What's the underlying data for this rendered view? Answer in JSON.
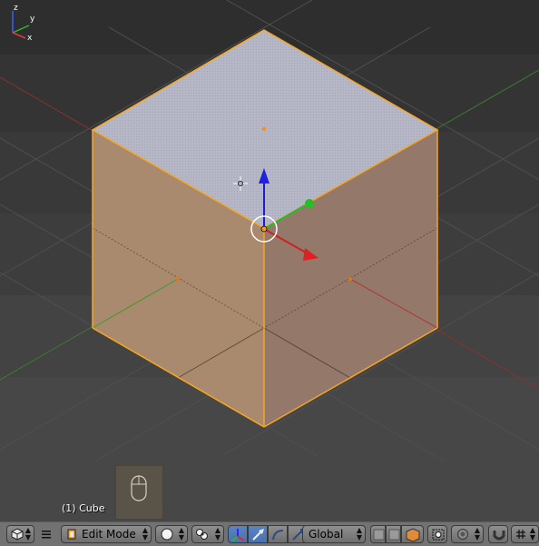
{
  "viewport": {
    "object_label": "(1) Cube",
    "axis_labels": {
      "x": "x",
      "y": "y",
      "z": "z"
    }
  },
  "header": {
    "editor_type_icon": "viewport-cube-icon",
    "menu_icon": "hamburger-menu-icon",
    "mode_label": "Edit Mode",
    "shading_icon": "solid-sphere-icon",
    "pivot_icon": "pivot-point-icon",
    "orientation_label": "Global",
    "colors": {
      "header_bg": "#727272",
      "active_blue": "#4a72ad",
      "selection_orange": "#f5a623"
    }
  }
}
